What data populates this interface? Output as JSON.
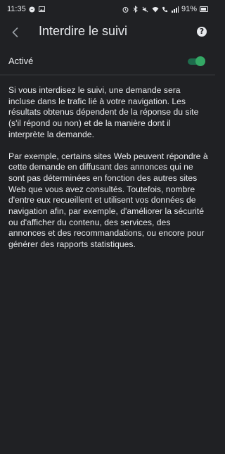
{
  "status_bar": {
    "time": "11:35",
    "battery_percent": "91%"
  },
  "header": {
    "title": "Interdire le suivi"
  },
  "setting": {
    "label": "Activé",
    "enabled": true
  },
  "body": {
    "paragraph_1": "Si vous interdisez le suivi, une demande sera incluse dans le trafic lié à votre navigation. Les résultats obtenus dépendent de la réponse du site (s'il répond ou non) et de la manière dont il interprète la demande.",
    "paragraph_2": "Par exemple, certains sites Web peuvent répondre à cette demande en diffusant des annonces qui ne sont pas déterminées en fonction des autres sites Web que vous avez consultés. Toutefois, nombre d'entre eux recueillent et utilisent vos données de navigation afin, par exemple, d'améliorer la sécurité ou d'afficher du contenu, des services, des annonces et des recommandations, ou encore pour générer des rapports statistiques."
  },
  "colors": {
    "background": "#202124",
    "text": "#e8eaed",
    "toggle_accent": "#34a865"
  }
}
